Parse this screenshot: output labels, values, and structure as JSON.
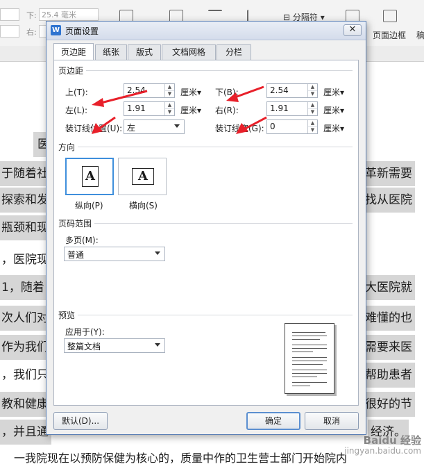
{
  "background": {
    "ribbon": {
      "down_label": "下:",
      "down_value": "25.4 毫米",
      "right_label": "右:",
      "separator_label": "分隔符",
      "page_border_label": "页面边框",
      "more_label": "稿"
    },
    "doc_lines": [
      {
        "left": "医",
        "right": ""
      },
      {
        "left": "于随着社",
        "right": "革新需要"
      },
      {
        "left": "探索和发",
        "right": "找从医院"
      },
      {
        "left": "瓶颈和现",
        "right": ""
      },
      {
        "left": "，医院现",
        "right": ""
      },
      {
        "left": "1，随着",
        "right": "大医院就"
      },
      {
        "left": "次人们对",
        "right": "难懂的也"
      },
      {
        "left": "作为我们",
        "right": "需要来医"
      },
      {
        "left": "，我们只",
        "right": "帮助患者"
      },
      {
        "left": "教和健康",
        "right": "很好的节"
      },
      {
        "left": "，并且通",
        "right": "经济。"
      },
      {
        "left": "一我院现在以预防保健为核心的，质量中作的卫生营士部门开始院内",
        "right": ""
      }
    ],
    "watermark": {
      "brand": "Baidu 经验",
      "url": "jingyan.baidu.com"
    }
  },
  "dialog": {
    "title": "页面设置",
    "logo": "W",
    "close_glyph": "✕",
    "tabs": [
      {
        "label": "页边距",
        "active": true
      },
      {
        "label": "纸张",
        "active": false
      },
      {
        "label": "版式",
        "active": false
      },
      {
        "label": "文档网格",
        "active": false
      },
      {
        "label": "分栏",
        "active": false
      }
    ],
    "margins": {
      "group_title": "页边距",
      "top": {
        "label": "上(T):",
        "value": "2.54",
        "unit": "厘米▾"
      },
      "bottom": {
        "label": "下(B):",
        "value": "2.54",
        "unit": "厘米▾"
      },
      "left": {
        "label": "左(L):",
        "value": "1.91",
        "unit": "厘米▾"
      },
      "right": {
        "label": "右(R):",
        "value": "1.91",
        "unit": "厘米▾"
      },
      "gutter_pos": {
        "label": "装订线位置(U):",
        "value": "左"
      },
      "gutter_width": {
        "label": "装订线宽(G):",
        "value": "0",
        "unit": "厘米▾"
      }
    },
    "orientation": {
      "group_title": "方向",
      "portrait": {
        "label": "纵向(P)",
        "glyph": "A",
        "selected": true
      },
      "landscape": {
        "label": "横向(S)",
        "glyph": "A",
        "selected": false
      }
    },
    "page_range": {
      "group_title": "页码范围",
      "multi_label": "多页(M):",
      "multi_value": "普通"
    },
    "preview": {
      "group_title": "预览",
      "apply_label": "应用于(Y):",
      "apply_value": "整篇文档"
    },
    "buttons": {
      "default": "默认(D)...",
      "ok": "确定",
      "cancel": "取消"
    }
  },
  "colors": {
    "dialog_border": "#5a7fb5",
    "selected_border": "#3f8fdc",
    "arrow_red": "#e8202a"
  }
}
